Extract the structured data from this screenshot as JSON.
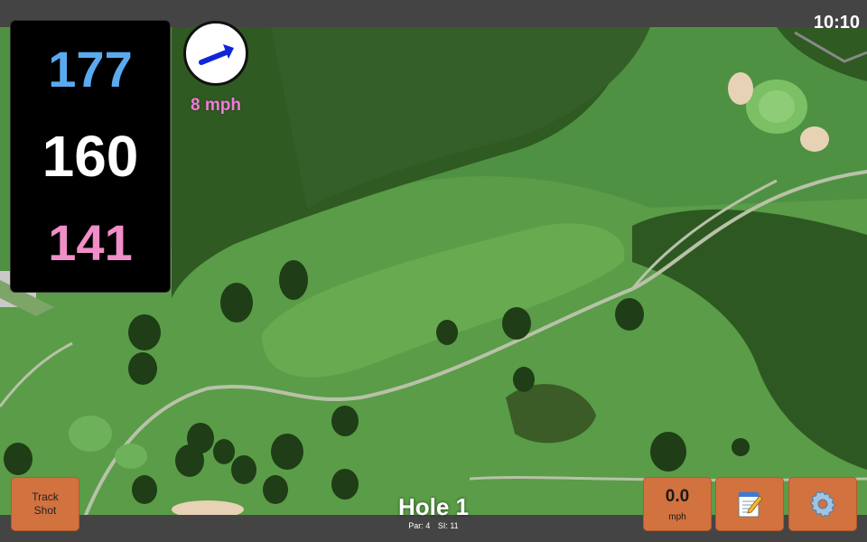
{
  "status_bar": {
    "time": "10:10"
  },
  "distances": {
    "back": "177",
    "middle": "160",
    "front": "141"
  },
  "wind": {
    "speed_label": "8 mph",
    "direction_icon": "arrow-icon"
  },
  "hole": {
    "title": "Hole 1",
    "par_label": "Par: 4",
    "si_label": "SI: 11"
  },
  "buttons": {
    "track_shot_line1": "Track",
    "track_shot_line2": "Shot",
    "speed_value": "0.0",
    "speed_unit": "mph",
    "notes_icon": "notepad-icon",
    "settings_icon": "gear-icon"
  },
  "colors": {
    "back_distance": "#5aaaf0",
    "middle_distance": "#ffffff",
    "front_distance": "#f08ec8",
    "wind_speed": "#f27ad8",
    "button_accent": "#d2723f"
  }
}
